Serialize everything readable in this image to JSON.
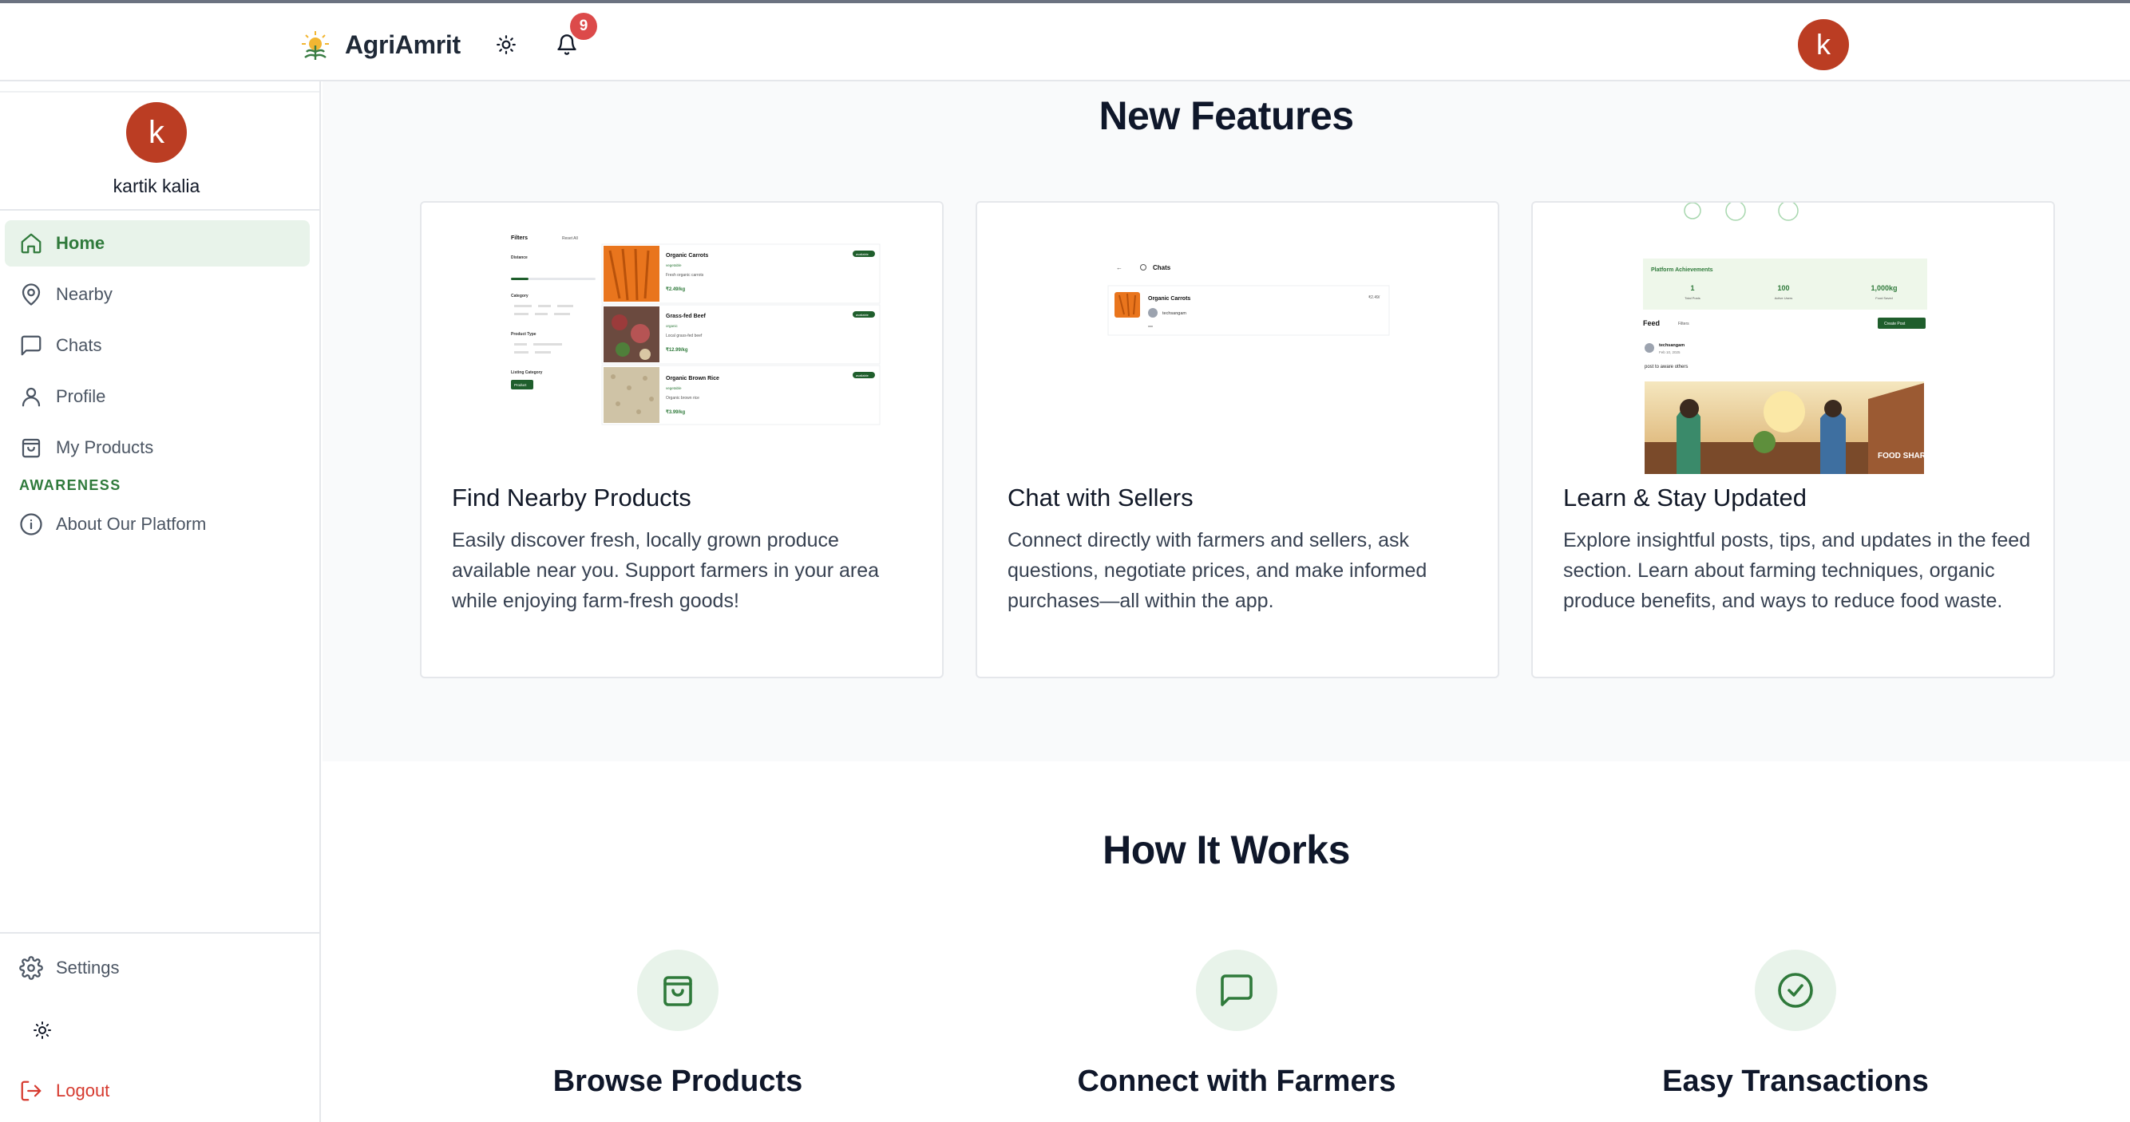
{
  "header": {
    "brand": "AgriAmrit",
    "notification_count": "9",
    "avatar_initial": "k"
  },
  "sidebar": {
    "avatar_initial": "k",
    "username": "kartik kalia",
    "items": [
      {
        "label": "Home",
        "icon": "home-icon",
        "active": true
      },
      {
        "label": "Nearby",
        "icon": "map-pin-icon"
      },
      {
        "label": "Chats",
        "icon": "chat-icon"
      },
      {
        "label": "Profile",
        "icon": "user-icon"
      },
      {
        "label": "My Products",
        "icon": "shopping-bag-icon"
      }
    ],
    "section_label": "AWARENESS",
    "awareness_items": [
      {
        "label": "About Our Platform",
        "icon": "info-icon"
      }
    ],
    "settings_label": "Settings",
    "logout_label": "Logout"
  },
  "features": {
    "title": "New Features",
    "cards": [
      {
        "title": "Find Nearby Products",
        "description": "Easily discover fresh, locally grown produce available near you. Support farmers in your area while enjoying farm-fresh goods!",
        "preview": {
          "filters_label": "Filters",
          "reset_label": "Reset All",
          "distance_label": "Distance",
          "category_label": "Category",
          "product_type_label": "Product Type",
          "listing_category_label": "Listing Category",
          "listing_button": "Product",
          "products": [
            {
              "name": "Organic Carrots",
              "tag": "vegetable",
              "desc": "Fresh organic carrots",
              "price": "₹2.49/kg",
              "badge": "available"
            },
            {
              "name": "Grass-fed Beef",
              "tag": "organic",
              "desc": "Local grass-fed beef",
              "price": "₹12.99/kg",
              "badge": "available"
            },
            {
              "name": "Organic Brown Rice",
              "tag": "vegetable",
              "desc": "Organic brown rice",
              "price": "₹3.99/kg",
              "badge": "available"
            }
          ]
        }
      },
      {
        "title": "Chat with Sellers",
        "description": "Connect directly with farmers and sellers, ask questions, negotiate prices, and make informed purchases—all within the app.",
        "preview": {
          "header": "Chats",
          "product": "Organic Carrots",
          "seller": "techsangam",
          "price": "₹2.49/"
        }
      },
      {
        "title": "Learn & Stay Updated",
        "description": "Explore insightful posts, tips, and updates in the feed section. Learn about farming techniques, organic produce benefits, and ways to reduce food waste.",
        "preview": {
          "achievements_title": "Platform Achievements",
          "stats": [
            {
              "value": "1",
              "label": "Total Posts"
            },
            {
              "value": "100",
              "label": "Active Users"
            },
            {
              "value": "1,000kg",
              "label": "Food Saved"
            }
          ],
          "feed_label": "Feed",
          "filters_label": "Filters",
          "create_post_label": "Create Post",
          "post_author": "techsangam",
          "post_date": "Feb 10, 2025",
          "post_text": "post to aware others",
          "image_caption": "FOOD SHARE"
        }
      }
    ]
  },
  "how": {
    "title": "How It Works",
    "steps": [
      {
        "title": "Browse Products",
        "icon": "shopping-bag-icon"
      },
      {
        "title": "Connect with Farmers",
        "icon": "chat-icon"
      },
      {
        "title": "Easy Transactions",
        "icon": "check-circle-icon"
      }
    ]
  },
  "colors": {
    "accent": "#2f7a3b",
    "accent_light": "#e8f3ea",
    "avatar": "#bb3d23",
    "badge": "#dc4a4a",
    "logout": "#d63a2f"
  }
}
